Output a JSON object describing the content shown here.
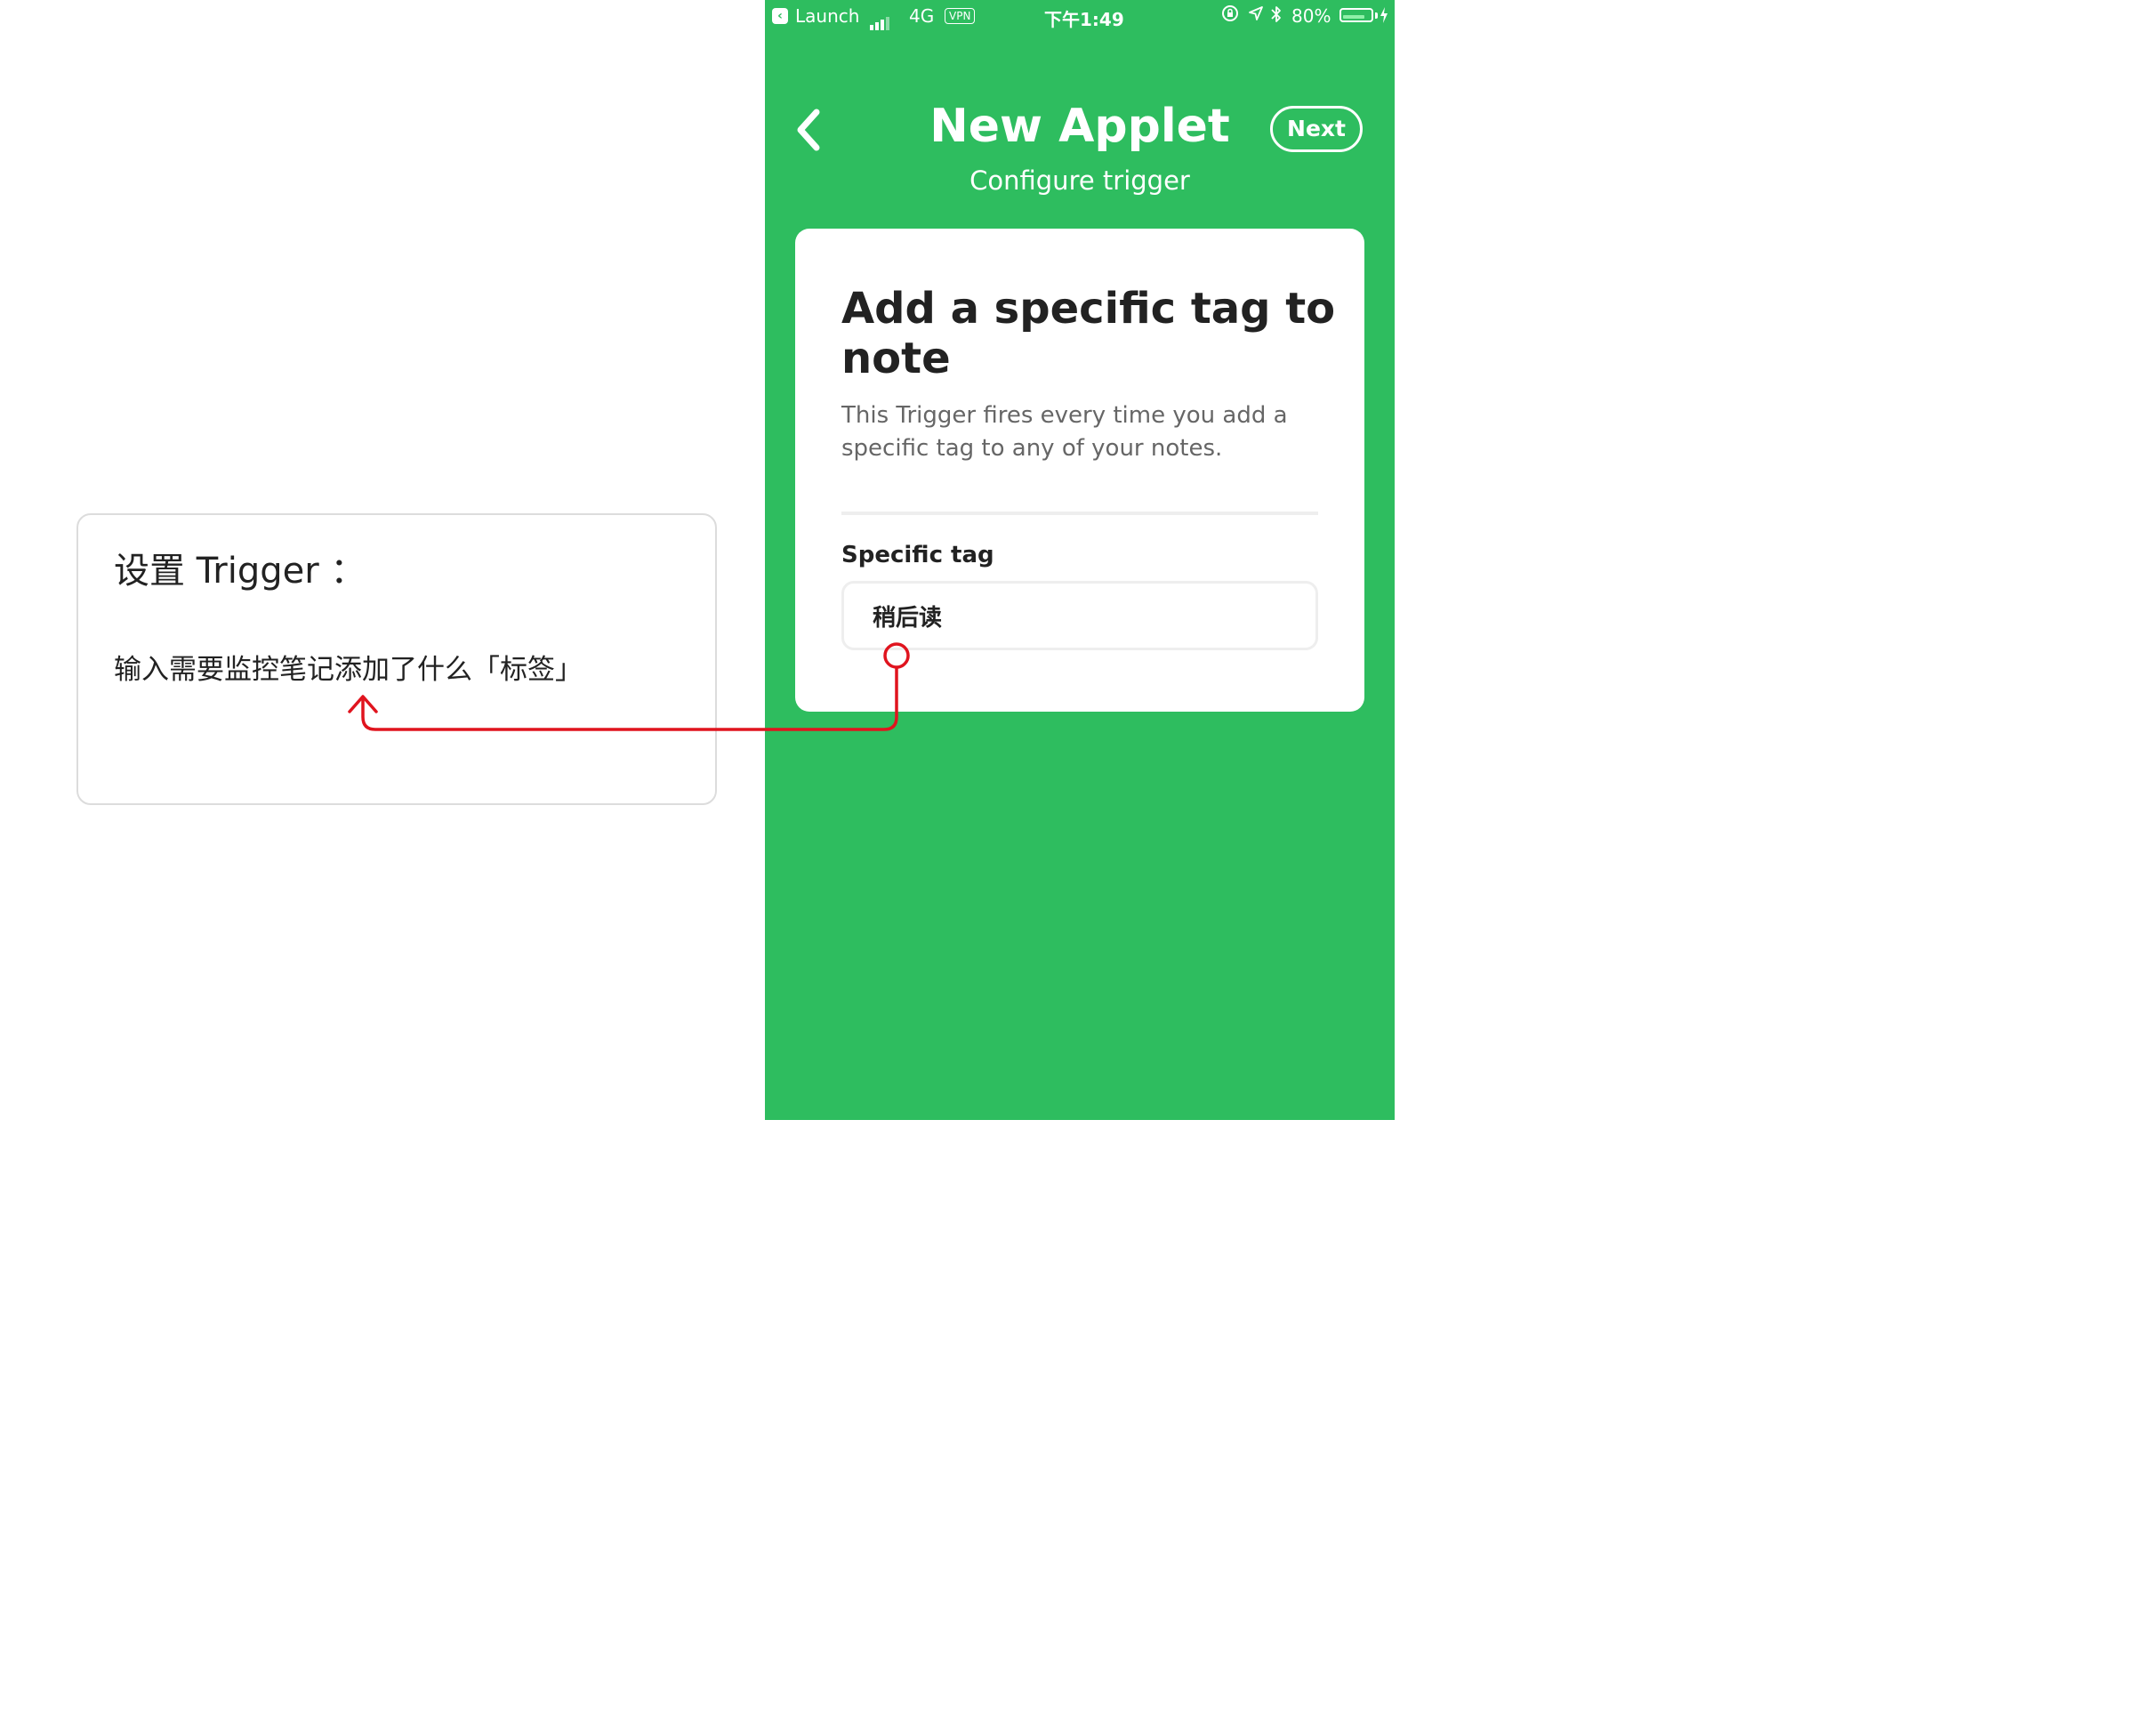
{
  "annotation": {
    "title": "设置 Trigger ：",
    "text": "输入需要监控笔记添加了什么「标签」"
  },
  "status_bar": {
    "back_app": "Launch",
    "network": "4G",
    "vpn": "VPN",
    "time": "下午1:49",
    "battery": "80%",
    "battery_level": 0.8
  },
  "header": {
    "title": "New Applet",
    "subtitle": "Configure trigger",
    "next_label": "Next"
  },
  "trigger": {
    "title": "Add a specific tag to note",
    "description": "This Trigger fires every time you add a specific tag to any of your notes.",
    "field_label": "Specific tag",
    "field_value": "稍后读"
  },
  "colors": {
    "brand_green": "#2ebd5f",
    "annotation_red": "#e0141e"
  },
  "icons": [
    "launch-back-icon",
    "signal-icon",
    "orientation-lock-icon",
    "location-icon",
    "bluetooth-icon",
    "battery-icon",
    "charging-icon",
    "back-chevron-icon"
  ]
}
